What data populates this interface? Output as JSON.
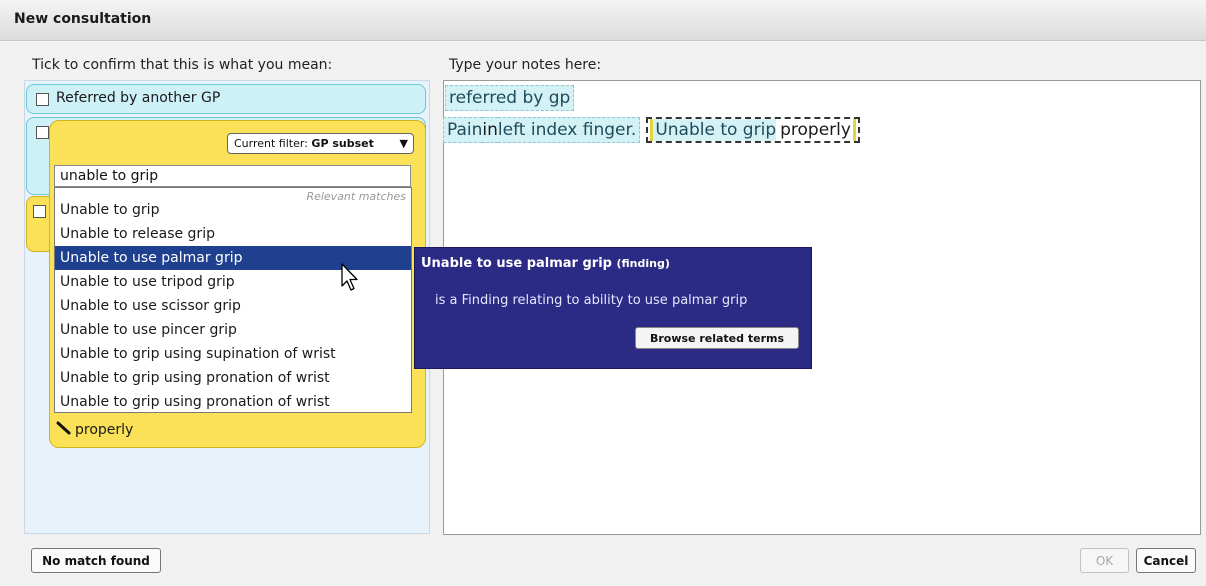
{
  "window": {
    "title": "New consultation"
  },
  "left": {
    "label": "Tick to confirm that this is what you mean:",
    "candidates": [
      {
        "label": "Referred by another GP",
        "checked": false
      },
      {
        "label": "",
        "checked": false
      },
      {
        "label": "",
        "checked": false
      }
    ]
  },
  "picker": {
    "filter_prefix": "Current filter: ",
    "filter_value": "GP subset",
    "filter_arrow": "▼",
    "search_value": "unable to grip",
    "relevant_label": "Relevant matches",
    "options": [
      "Unable to grip",
      "Unable to release grip",
      "Unable to use palmar grip",
      "Unable to use tripod grip",
      "Unable to use scissor grip",
      "Unable to use pincer grip",
      "Unable to grip using supination of wrist",
      "Unable to grip using pronation of wrist",
      "Unable to grip using pronation of wrist"
    ],
    "selected_index": 2,
    "token_label": "properly",
    "token_icon": "pencil-icon"
  },
  "popup": {
    "title": "Unable to use palmar grip",
    "tag": "(finding)",
    "description": "is a Finding relating to ability to use palmar grip",
    "button": "Browse related terms"
  },
  "notes": {
    "label": "Type your notes here:",
    "line1": "referred by gp",
    "line2_pre": "Pain",
    "line2_in": " in ",
    "line2_mid": "left index finger.",
    "line2_grip": "Unable to grip",
    "line2_properly": " properly"
  },
  "buttons": {
    "no_match": "No match found",
    "ok": "OK",
    "cancel": "Cancel"
  },
  "colors": {
    "selection": "#1f3f8f",
    "picker_bg": "#fae157",
    "popup_bg": "#2b2a85",
    "chip_bg": "#d4f2f5"
  }
}
